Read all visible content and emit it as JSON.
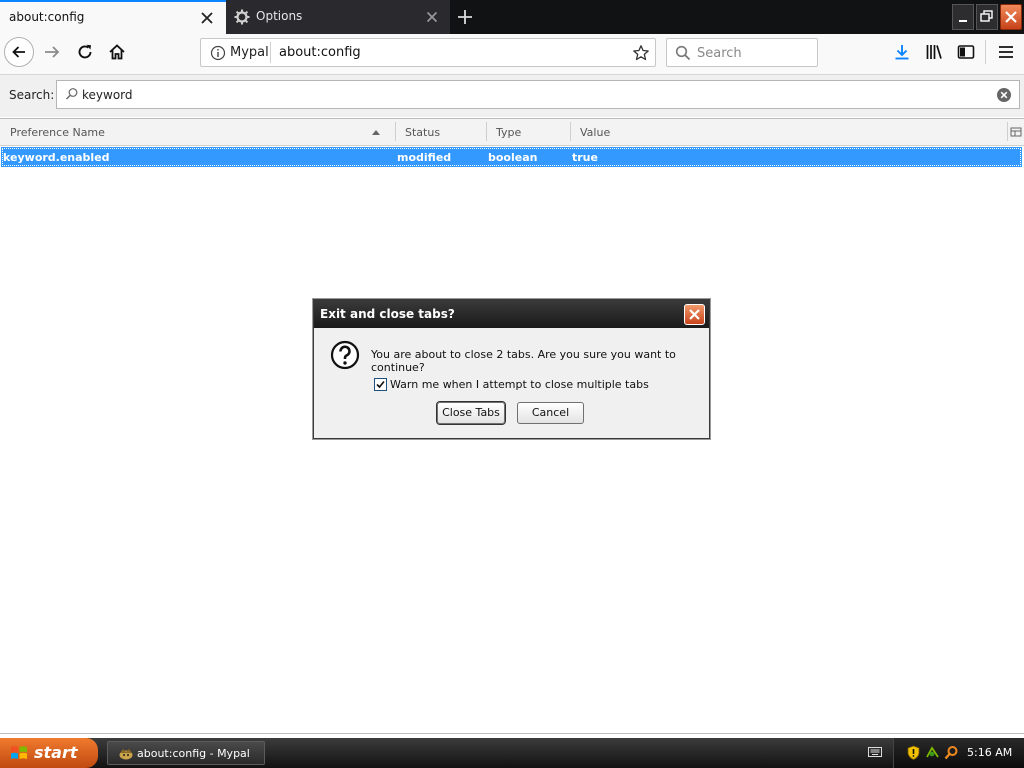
{
  "browser": {
    "tabs": [
      {
        "title": "about:config",
        "active": true
      },
      {
        "title": "Options",
        "active": false
      }
    ],
    "identity_label": "Mypal",
    "url": "about:config",
    "search_placeholder": "Search"
  },
  "config": {
    "search_label": "Search:",
    "search_value": "keyword",
    "columns": [
      "Preference Name",
      "Status",
      "Type",
      "Value"
    ],
    "rows": [
      {
        "name": "keyword.enabled",
        "status": "modified",
        "type": "boolean",
        "value": "true"
      }
    ]
  },
  "dialog": {
    "title": "Exit and close tabs?",
    "message": "You are about to close 2 tabs. Are you sure you want to continue?",
    "checkbox_label": "Warn me when I attempt to close multiple tabs",
    "checkbox_checked": true,
    "confirm_label": "Close Tabs",
    "cancel_label": "Cancel"
  },
  "taskbar": {
    "start_label": "start",
    "window_label": "about:config - Mypal",
    "clock": "5:16 AM"
  },
  "colors": {
    "accent": "#0a84ff",
    "selection": "#3399ff",
    "start_button": "#e0601f"
  }
}
